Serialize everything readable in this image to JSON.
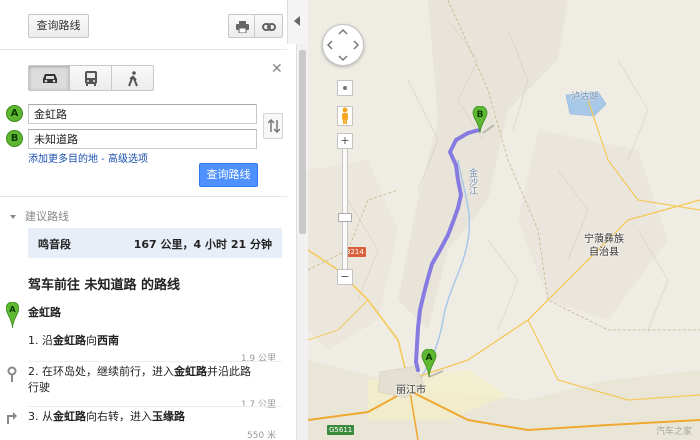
{
  "toolbar": {
    "search_button": "查询路线",
    "print_icon": "print-icon",
    "link_icon": "link-icon"
  },
  "modes": {
    "selected": "driving",
    "items": [
      "driving",
      "transit",
      "walking"
    ]
  },
  "inputs": {
    "start_marker": "A",
    "end_marker": "B",
    "start_value": "金虹路",
    "end_value": "未知道路"
  },
  "links": {
    "add_destination": "添加更多目的地",
    "separator": " - ",
    "advanced_options": "高级选项"
  },
  "search_button": "查询路线",
  "suggested": {
    "header": "建议路线",
    "route_name": "鸣音段",
    "route_summary": "167 公里，4 小时 21 分钟"
  },
  "directions": {
    "title": "驾车前往 未知道路 的路线",
    "start_label": "金虹路",
    "steps": [
      {
        "num": "1.",
        "pre": "沿",
        "b1": "金虹路",
        "mid": "向",
        "b2": "西南",
        "post": "",
        "distance": "1.9 公里"
      },
      {
        "num": "2.",
        "pre": "在环岛处，继续前行，进入",
        "b1": "金虹路",
        "mid": "并沿此路行驶",
        "b2": "",
        "post": "",
        "distance": "1.7 公里"
      },
      {
        "num": "3.",
        "pre": "从",
        "b1": "金虹路",
        "mid": "向右转，进入",
        "b2": "玉缘路",
        "post": "",
        "distance": "550 米"
      }
    ]
  },
  "map": {
    "lake_label": "泸沽湖",
    "river_label": "金沙江",
    "county_label_1": "宁蒗彝族",
    "county_label_2": "自治县",
    "city_label": "丽江市",
    "shield_1": "G5611",
    "shield_2": "3214",
    "route_color": "#7b6fe0",
    "pin_a": "A",
    "pin_b": "B",
    "zoom_plus": "+",
    "zoom_minus": "−",
    "watermark": "汽车之家"
  }
}
